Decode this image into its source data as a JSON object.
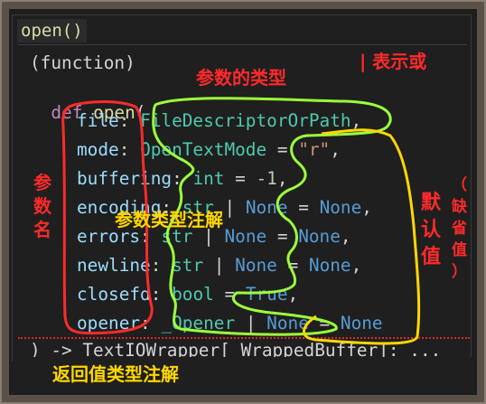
{
  "hover": {
    "title": "open()"
  },
  "code": {
    "line1": "(function)",
    "def_kw": "def",
    "fn_name": "open",
    "paren_open": "(",
    "params": [
      {
        "name": "file",
        "colon": ": ",
        "type": "FileDescriptorOrPath",
        "rest": ","
      },
      {
        "name": "mode",
        "colon": ": ",
        "type": "OpenTextMode",
        "eq": " = ",
        "default": "\"r\"",
        "rest": ","
      },
      {
        "name": "buffering",
        "colon": ": ",
        "type": "int",
        "eq": " = ",
        "default": "-1",
        "rest": ","
      },
      {
        "name": "encoding",
        "colon": ": ",
        "type": "str",
        "pipe": " | ",
        "none": "None",
        "eq": " = ",
        "default": "None",
        "rest": ","
      },
      {
        "name": "errors",
        "colon": ": ",
        "type": "str",
        "pipe": " | ",
        "none": "None",
        "eq": " = ",
        "default": "None",
        "rest": ","
      },
      {
        "name": "newline",
        "colon": ": ",
        "type": "str",
        "pipe": " | ",
        "none": "None",
        "eq": " = ",
        "default": "None",
        "rest": ","
      },
      {
        "name": "closefd",
        "colon": ": ",
        "type": "bool",
        "eq": " = ",
        "default": "True",
        "rest": ","
      },
      {
        "name": "opener",
        "colon": ": ",
        "type": "_Opener",
        "pipe": " | ",
        "none": "None",
        "eq": " = ",
        "default": "None",
        "rest": ""
      }
    ],
    "return_line": ") -> TextIOWrapper[_WrappedBuffer]: ..."
  },
  "annotations": {
    "param_type": "参数的类型",
    "or": "| 表示或",
    "param_name_1": "参",
    "param_name_2": "数",
    "param_name_3": "名",
    "type_hint": "参数类型注解",
    "default_1": "默",
    "default_2": "认",
    "default_3": "值",
    "missing_1": "（",
    "missing_2": "缺",
    "missing_3": "省",
    "missing_4": "值",
    "missing_5": "）",
    "return_hint": "返回值类型注解"
  },
  "colors": {
    "red": "#ff2a2a",
    "yellow": "#ffd700",
    "green": "#9cff3c"
  }
}
